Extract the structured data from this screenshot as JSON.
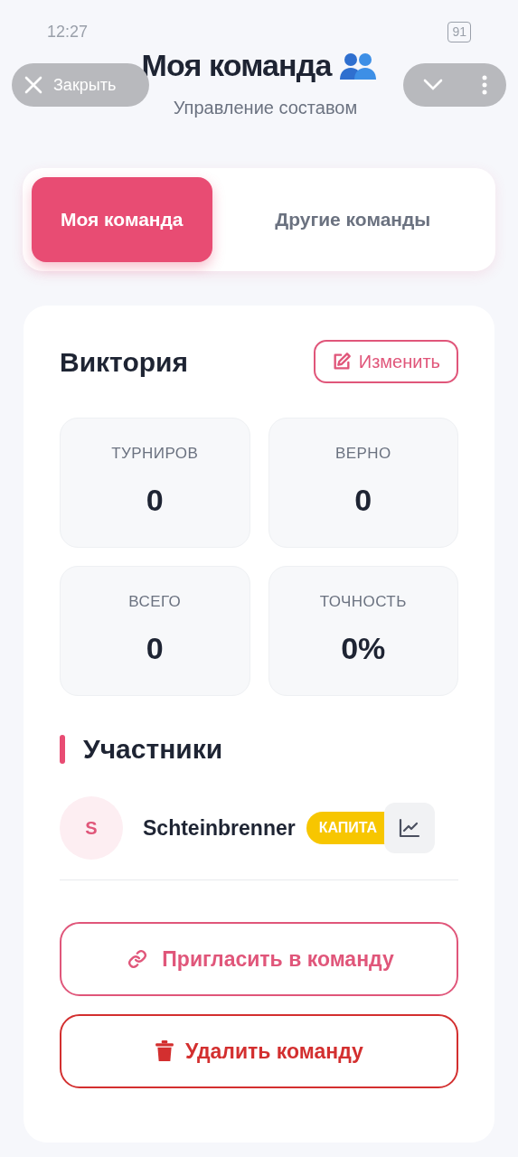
{
  "status_bar": {
    "time": "12:27",
    "battery": "91"
  },
  "header": {
    "title": "Моя команда",
    "subtitle": "Управление составом"
  },
  "overlay": {
    "close_label": "Закрыть"
  },
  "tabs": [
    {
      "label": "Моя команда",
      "selected": true
    },
    {
      "label": "Другие команды",
      "selected": false
    }
  ],
  "team": {
    "name": "Виктория",
    "edit_label": "Изменить"
  },
  "stats": [
    {
      "label": "ТУРНИРОВ",
      "value": "0"
    },
    {
      "label": "ВЕРНО",
      "value": "0"
    },
    {
      "label": "ВСЕГО",
      "value": "0"
    },
    {
      "label": "ТОЧНОСТЬ",
      "value": "0%"
    }
  ],
  "members_title": "Участники",
  "members": [
    {
      "initial": "S",
      "name": "Schteinbrenner",
      "badge": "КАПИТА"
    }
  ],
  "actions": [
    {
      "kind": "invite",
      "label": "Пригласить в команду"
    },
    {
      "kind": "delete",
      "label": "Удалить команду"
    }
  ]
}
